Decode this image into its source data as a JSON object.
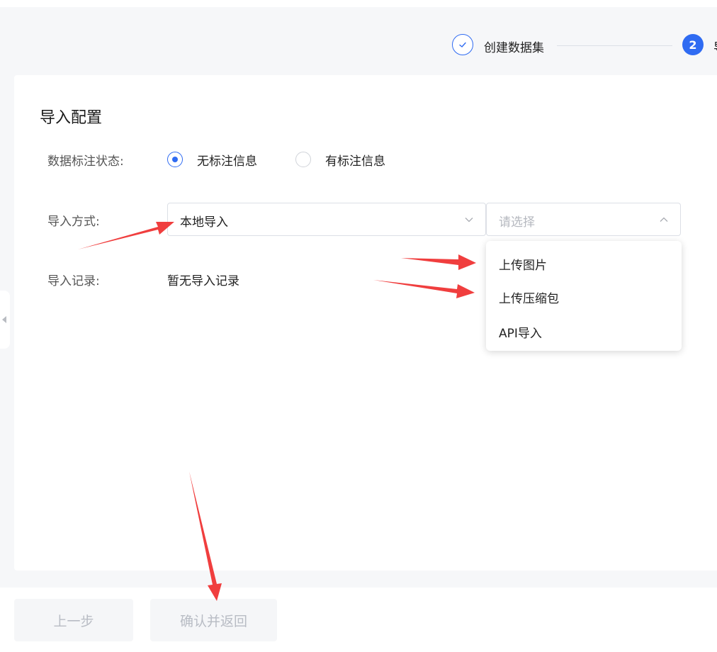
{
  "steps": [
    {
      "label": "创建数据集",
      "state": "done"
    },
    {
      "number": "2",
      "label": "导",
      "state": "active"
    }
  ],
  "section_title": "导入配置",
  "annotation_status": {
    "label": "数据标注状态:",
    "options": [
      {
        "label": "无标注信息",
        "checked": true
      },
      {
        "label": "有标注信息",
        "checked": false
      }
    ]
  },
  "import_method": {
    "label": "导入方式:",
    "value": "本地导入",
    "sub_placeholder": "请选择",
    "options": [
      "上传图片",
      "上传压缩包",
      "API导入"
    ]
  },
  "import_record": {
    "label": "导入记录:",
    "value": "暂无导入记录"
  },
  "footer": {
    "prev_label": "上一步",
    "confirm_label": "确认并返回"
  },
  "colors": {
    "primary": "#2f6bf2",
    "annotation_arrow": "#f03e3e",
    "disabled_text": "#b8bcc4"
  }
}
